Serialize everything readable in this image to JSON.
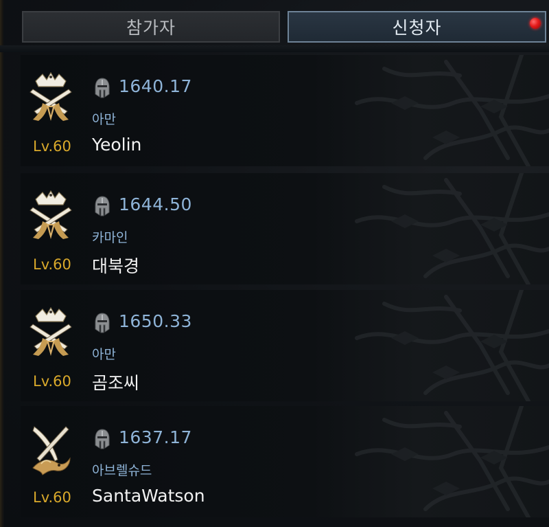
{
  "tabs": [
    {
      "label": "참가자",
      "active": false
    },
    {
      "label": "신청자",
      "active": true,
      "notification": true
    }
  ],
  "colors": {
    "item_level": "#8fb4d8",
    "class_name": "#8fb4d8",
    "level": "#d9a92b",
    "name": "#f2f2f2",
    "active_tab_border": "#6e8397",
    "notification_dot": "#e51b1b"
  },
  "members": [
    {
      "emblem": "crown-crossed-swords-emblem-icon",
      "item_level": "1640.17",
      "class": "아만",
      "level": "Lv.60",
      "name": "Yeolin"
    },
    {
      "emblem": "crown-crossed-swords-emblem-icon",
      "item_level": "1644.50",
      "class": "카마인",
      "level": "Lv.60",
      "name": "대북경"
    },
    {
      "emblem": "crown-crossed-swords-emblem-icon",
      "item_level": "1650.33",
      "class": "아만",
      "level": "Lv.60",
      "name": "곰조씨"
    },
    {
      "emblem": "dragon-crossed-blades-emblem-icon",
      "item_level": "1637.17",
      "class": "아브렐슈드",
      "level": "Lv.60",
      "name": "SantaWatson"
    }
  ]
}
